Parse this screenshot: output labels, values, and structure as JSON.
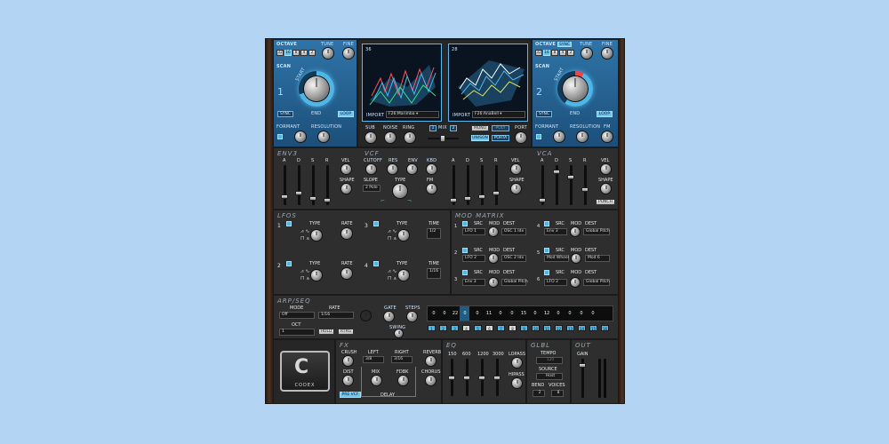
{
  "oscillator_left": {
    "octave_label": "OCTAVE",
    "tune_label": "TUNE",
    "fine_label": "FINE",
    "octave_buttons": [
      "32",
      "16",
      "8",
      "4",
      "2"
    ],
    "scan_label": "SCAN",
    "number": "1",
    "start_label": "START",
    "end_label": "END",
    "sync_label": "SYNC",
    "loop_label": "LOOP",
    "formant_label": "FORMANT",
    "resolution_label": "RESOLUTION"
  },
  "oscillator_right": {
    "octave_label": "OCTAVE",
    "sync_top_label": "SYNC",
    "tune_label": "TUNE",
    "fine_label": "FINE",
    "octave_buttons": [
      "32",
      "16",
      "8",
      "4",
      "2"
    ],
    "scan_label": "SCAN",
    "number": "2",
    "start_label": "START",
    "end_label": "END",
    "sync_label": "SYNC",
    "loop_label": "LOOP",
    "formant_label": "FORMANT",
    "resolution_label": "RESOLUTION",
    "fm_label": "FM"
  },
  "wave_display_left": {
    "index": "36",
    "import_label": "IMPORT",
    "file": "F26:Marimba"
  },
  "wave_display_right": {
    "index": "28",
    "import_label": "IMPORT",
    "file": "F26:AnaBell"
  },
  "mixer": {
    "sub_label": "SUB",
    "noise_label": "NOISE",
    "ring_label": "RING",
    "mix_label": "MIX",
    "num_1": "1",
    "num_2": "2",
    "port_label": "PORT",
    "mono_label": "MONO",
    "poly_label": "POLY",
    "unison_label": "UNISON",
    "porta_label": "PORTA"
  },
  "env3": {
    "title": "ENV3",
    "labels": [
      "A",
      "D",
      "S",
      "R"
    ],
    "vel_label": "VEL",
    "shape_label": "SHAPE"
  },
  "vcf": {
    "title": "VCF",
    "cutoff_label": "CUTOFF",
    "res_label": "RES",
    "env_label": "ENV",
    "kbd_label": "KBD",
    "slope_label": "SLOPE",
    "slope_value": "2 Pole",
    "type_label": "TYPE",
    "fm_label": "FM",
    "adsr": [
      "A",
      "D",
      "S",
      "R"
    ],
    "vel_label": "VEL",
    "shape_label": "SHAPE"
  },
  "vca": {
    "title": "VCA",
    "labels": [
      "A",
      "D",
      "S",
      "R"
    ],
    "vel_label": "VEL",
    "shape_label": "SHAPE",
    "punch_label": "PUNCH"
  },
  "lfos": {
    "title": "LFOS",
    "items": [
      {
        "num": "1",
        "type_label": "TYPE",
        "rate_label": "RATE"
      },
      {
        "num": "2",
        "type_label": "TYPE",
        "rate_label": "RATE"
      },
      {
        "num": "3",
        "type_label": "TYPE",
        "time_label": "TIME",
        "time_value": "1/2"
      },
      {
        "num": "4",
        "type_label": "TYPE",
        "time_label": "TIME",
        "time_value": "1/16"
      }
    ]
  },
  "mod_matrix": {
    "title": "MOD MATRIX",
    "src_label": "SRC",
    "mod_label": "MOD",
    "dest_label": "DEST",
    "slots": [
      {
        "num": "1",
        "src": "LFO 1",
        "dest": "OSC 1 Idx"
      },
      {
        "num": "2",
        "src": "LFO 2",
        "dest": "OSC 2 Idx"
      },
      {
        "num": "3",
        "src": "Env 3",
        "dest": "Global Pitch"
      },
      {
        "num": "4",
        "src": "Env 3",
        "dest": "Global Pitch"
      },
      {
        "num": "5",
        "src": "Mod Wheel",
        "dest": "Mod 6"
      },
      {
        "num": "6",
        "src": "LFO 2",
        "dest": "Global Pitch"
      }
    ]
  },
  "arpseq": {
    "title": "ARP/SEQ",
    "mode_label": "MODE",
    "mode_value": "Off",
    "rate_label": "RATE",
    "rate_value": "1/16",
    "oct_label": "OCT",
    "oct_value": "1",
    "hold_label": "HOLD",
    "rtrg_label": "RTRG",
    "gate_label": "GATE",
    "steps_label": "STEPS",
    "swing_label": "SWING",
    "step_values": [
      "0",
      "0",
      "22",
      "0",
      "0",
      "11",
      "0",
      "0",
      "15",
      "0",
      "12",
      "0",
      "0",
      "0",
      "0"
    ],
    "step_numbers": [
      "1",
      "2",
      "3",
      "4",
      "5",
      "6",
      "7",
      "8",
      "9",
      "10",
      "11",
      "12",
      "13",
      "14",
      "15",
      "16"
    ]
  },
  "fx": {
    "title": "FX",
    "crush_label": "CRUSH",
    "left_label": "LEFT",
    "right_label": "RIGHT",
    "reverb_label": "REVERB",
    "left_value": "3/8",
    "right_value": "3/16",
    "dist_label": "DIST",
    "mix_label": "MIX",
    "fdbk_label": "FDBK",
    "chorus_label": "CHORUS",
    "delay_label": "DELAY",
    "pre_vcf_label": "PRE VCF"
  },
  "eq": {
    "title": "EQ",
    "bands": [
      "150",
      "600",
      "1200",
      "3000"
    ],
    "lopass_label": "LOPASS",
    "hipass_label": "HIPASS"
  },
  "glbl": {
    "title": "GLBL",
    "tempo_label": "TEMPO",
    "tempo_value": "120",
    "source_label": "SOURCE",
    "source_value": "Host",
    "bend_label": "BEND",
    "voices_label": "VOICES",
    "bend_value": "2",
    "voices_value": "8"
  },
  "out": {
    "title": "OUT",
    "gain_label": "GAIN"
  },
  "logo": {
    "text": "CODEX"
  },
  "colors": {
    "background": "#b3d4f2",
    "accent": "#4fb6e6",
    "panel_blue": "#2f74a8",
    "panel_dark": "#2e2e2e"
  }
}
